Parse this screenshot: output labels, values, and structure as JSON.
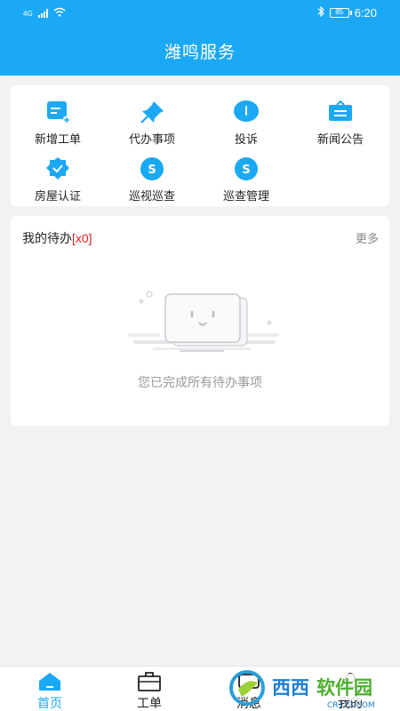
{
  "statusbar": {
    "network": "4G",
    "battery": "85",
    "time": "6:20"
  },
  "header": {
    "title": "潍鸣服务"
  },
  "menu": {
    "items": [
      {
        "label": "新增工单",
        "icon": "new-ticket-icon"
      },
      {
        "label": "代办事项",
        "icon": "pin-icon"
      },
      {
        "label": "投诉",
        "icon": "complaint-icon"
      },
      {
        "label": "新闻公告",
        "icon": "announcement-icon"
      },
      {
        "label": "房屋认证",
        "icon": "house-verify-icon"
      },
      {
        "label": "巡视巡查",
        "icon": "patrol-icon"
      },
      {
        "label": "巡查管理",
        "icon": "patrol-manage-icon"
      }
    ]
  },
  "todo": {
    "title": "我的待办",
    "count": "[x0]",
    "more": "更多",
    "empty_text": "您已完成所有待办事项"
  },
  "nav": {
    "items": [
      {
        "label": "首页",
        "icon": "home-icon",
        "active": true
      },
      {
        "label": "工单",
        "icon": "briefcase-icon",
        "active": false
      },
      {
        "label": "消息",
        "icon": "message-icon",
        "active": false
      },
      {
        "label": "我的",
        "icon": "profile-icon",
        "active": false
      }
    ]
  },
  "watermark": {
    "text": "西西软件园",
    "sub": "CR173.com"
  },
  "colors": {
    "brand": "#1ba9f5",
    "accent_red": "#e02020"
  }
}
